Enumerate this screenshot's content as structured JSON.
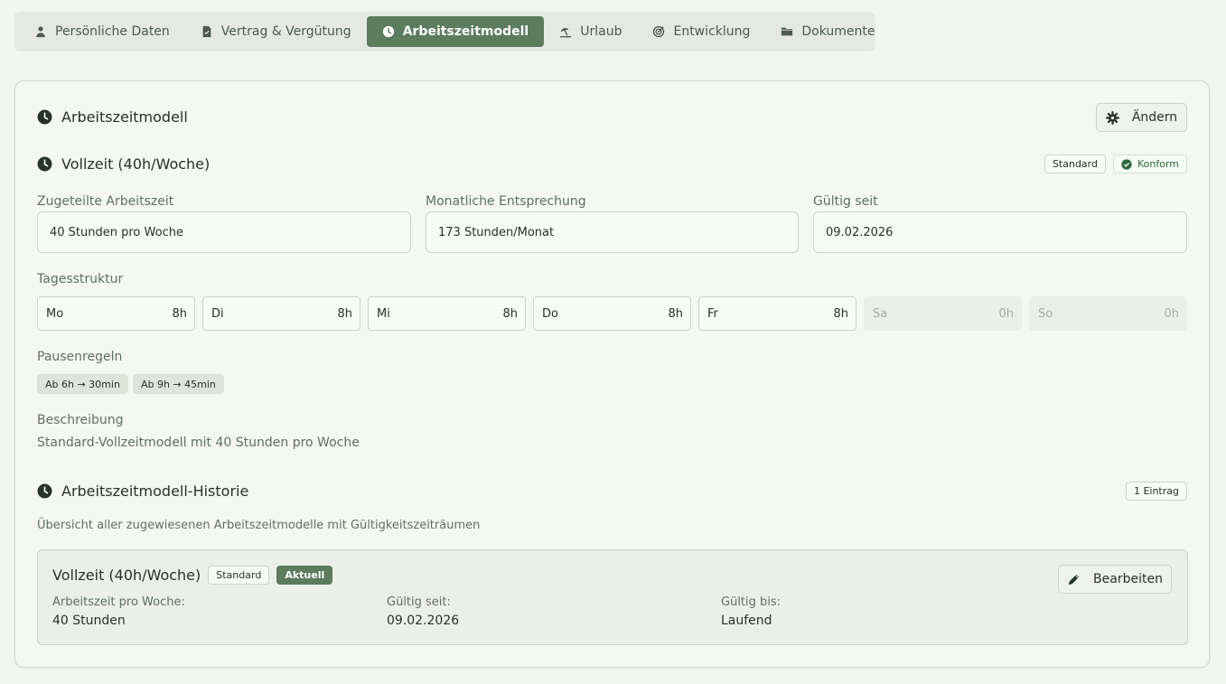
{
  "tabs": [
    {
      "label": "Persönliche Daten",
      "icon": "person-icon"
    },
    {
      "label": "Vertrag & Vergütung",
      "icon": "contract-icon"
    },
    {
      "label": "Arbeitszeitmodell",
      "icon": "clock-icon",
      "active": true
    },
    {
      "label": "Urlaub",
      "icon": "beach-icon"
    },
    {
      "label": "Entwicklung",
      "icon": "target-icon"
    },
    {
      "label": "Dokumente",
      "icon": "folder-icon"
    }
  ],
  "model": {
    "title": "Arbeitszeitmodell",
    "edit_label": "Ändern",
    "name": "Vollzeit (40h/Woche)",
    "badge_standard": "Standard",
    "badge_conform": "Konform",
    "fields": {
      "assigned_label": "Zugeteilte Arbeitszeit",
      "assigned_value": "40 Stunden pro Woche",
      "monthly_label": "Monatliche Entsprechung",
      "monthly_value": "173 Stunden/Monat",
      "valid_label": "Gültig seit",
      "valid_value": "09.02.2026"
    },
    "day_structure_label": "Tagesstruktur",
    "days": [
      {
        "day": "Mo",
        "hours": "8h"
      },
      {
        "day": "Di",
        "hours": "8h"
      },
      {
        "day": "Mi",
        "hours": "8h"
      },
      {
        "day": "Do",
        "hours": "8h"
      },
      {
        "day": "Fr",
        "hours": "8h"
      },
      {
        "day": "Sa",
        "hours": "0h"
      },
      {
        "day": "So",
        "hours": "0h"
      }
    ],
    "break_rules_label": "Pausenregeln",
    "break_rules": [
      "Ab 6h → 30min",
      "Ab 9h → 45min"
    ],
    "description_label": "Beschreibung",
    "description": "Standard-Vollzeitmodell mit 40 Stunden pro Woche"
  },
  "history": {
    "title": "Arbeitszeitmodell-Historie",
    "count_badge": "1 Eintrag",
    "subtitle": "Übersicht aller zugewiesenen Arbeitszeitmodelle mit Gültigkeitszeiträumen",
    "entry": {
      "name": "Vollzeit (40h/Woche)",
      "badge_standard": "Standard",
      "badge_current": "Aktuell",
      "edit_label": "Bearbeiten",
      "hours_label": "Arbeitszeit pro Woche:",
      "hours_value": "40 Stunden",
      "from_label": "Gültig seit:",
      "from_value": "09.02.2026",
      "to_label": "Gültig bis:",
      "to_value": "Laufend"
    }
  },
  "colors": {
    "accent": "#5c7c5e",
    "background": "#f3f5f0",
    "ok": "#2c6b3b"
  }
}
